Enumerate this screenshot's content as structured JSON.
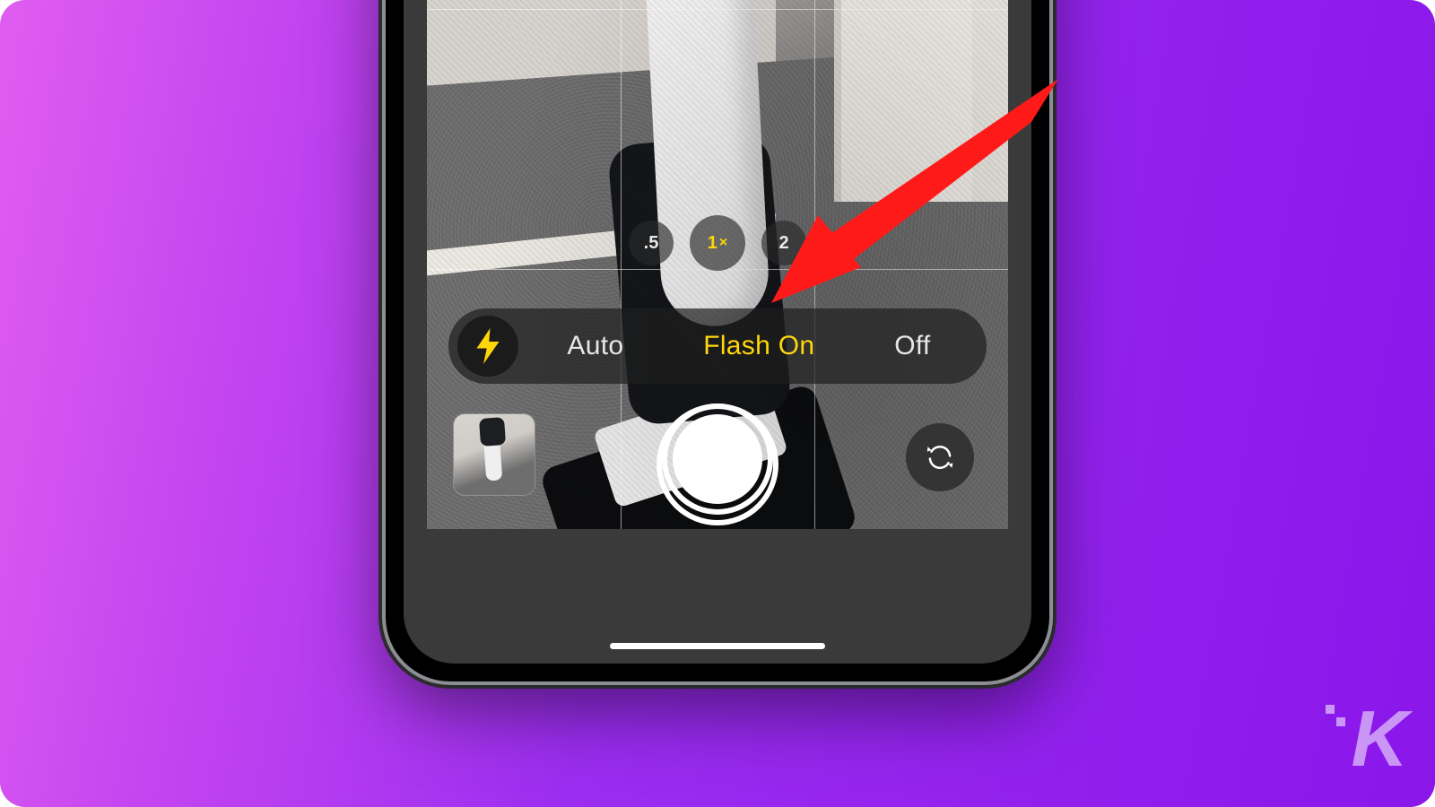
{
  "zoom": {
    "options": [
      {
        "label": ".5",
        "selected": false
      },
      {
        "label": "1",
        "suffix": "×",
        "selected": true
      },
      {
        "label": "2",
        "selected": false
      }
    ]
  },
  "flash": {
    "icon": "flash-bolt-icon",
    "options": [
      {
        "label": "Auto",
        "selected": false
      },
      {
        "label": "Flash On",
        "selected": true
      },
      {
        "label": "Off",
        "selected": false
      }
    ]
  },
  "controls": {
    "thumbnail": "last-photo-thumbnail",
    "shutter": "shutter-button",
    "flip": "flip-camera-button"
  },
  "colors": {
    "accent_yellow": "#ffd60a",
    "arrow_red": "#ff1a1a"
  },
  "watermark": {
    "text": "K"
  }
}
